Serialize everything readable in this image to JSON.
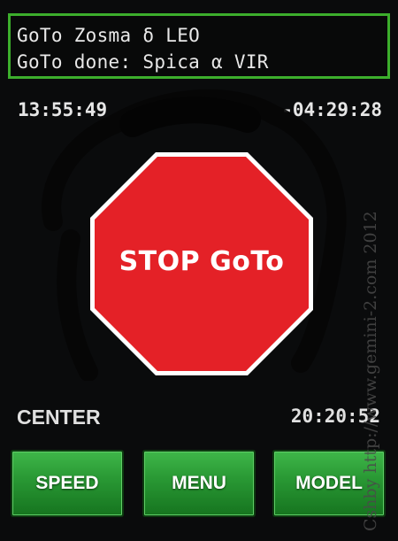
{
  "status": {
    "line1": "GoTo Zosma δ LEO",
    "line2": "GoTo done: Spica α VIR"
  },
  "clock": {
    "local_time": "13:55:49",
    "hour_angle": "-04:29:28"
  },
  "stop_button": {
    "label": "STOP GoTo",
    "color": "#e42127"
  },
  "footer": {
    "mode": "CENTER",
    "time": "20:20:52"
  },
  "buttons": {
    "speed": "SPEED",
    "menu": "MENU",
    "model": "MODEL"
  },
  "watermark": "Cshby http://www.gemini-2.com 2012",
  "colors": {
    "accent": "#3cae2c",
    "button_green": "#2a9a35",
    "stop_red": "#e42127"
  }
}
